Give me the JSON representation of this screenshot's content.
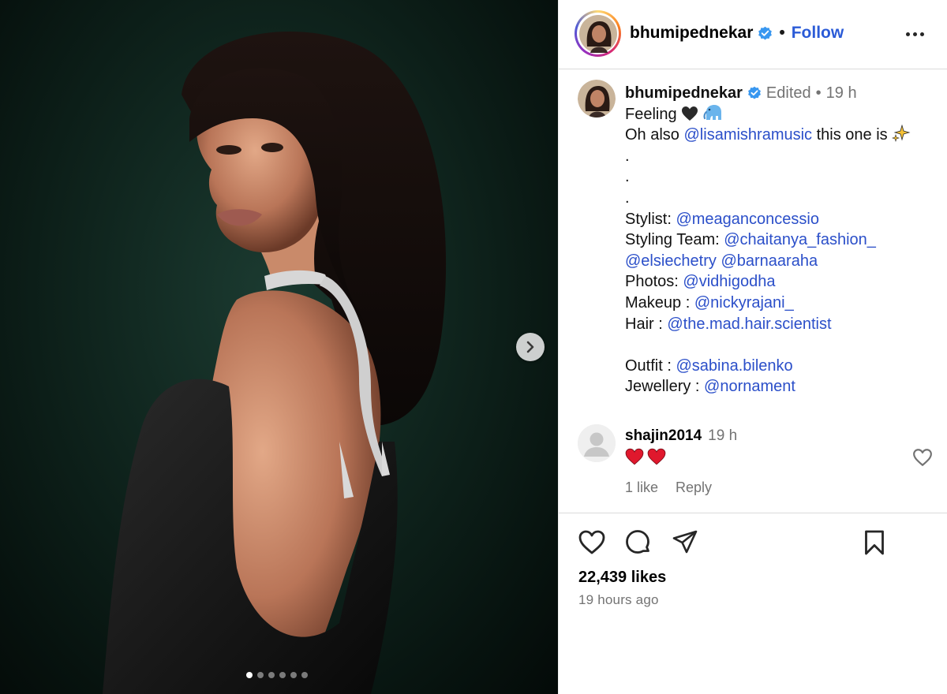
{
  "post": {
    "author": "bhumipednekar",
    "separator": "•",
    "follow_label": "Follow",
    "carousel": {
      "total_slides": 6,
      "current_slide": 1
    }
  },
  "caption": {
    "username": "bhumipednekar",
    "edited_label": "Edited",
    "dot": "•",
    "time": "19 h",
    "line1_text": "Feeling",
    "line2_prefix": "Oh also",
    "line2_mention": "@lisamishramusic",
    "line2_suffix": "this one is",
    "dot_lines": [
      ".",
      ".",
      "."
    ],
    "stylist_label": "Stylist:",
    "stylist": "@meaganconcessio",
    "styling_team_label": "Styling Team:",
    "styling_team_1": "@chaitanya_fashion_",
    "styling_team_2": "@elsiechetry",
    "styling_team_3": "@barnaaraha",
    "photos_label": "Photos:",
    "photos": "@vidhigodha",
    "makeup_label": "Makeup :",
    "makeup": "@nickyrajani_",
    "hair_label": "Hair :",
    "hair": "@the.mad.hair.scientist",
    "outfit_label": "Outfit :",
    "outfit": "@sabina.bilenko",
    "jewellery_label": "Jewellery :",
    "jewellery": "@nornament"
  },
  "comment": {
    "username": "shajin2014",
    "time": "19 h",
    "likes_label": "1 like",
    "reply_label": "Reply"
  },
  "footer": {
    "likes": "22,439 likes",
    "posted": "19 hours ago"
  },
  "colors": {
    "mention": "#2b4fc9",
    "follow": "#2b5bd7",
    "muted": "#737373",
    "verified": "#3897f0",
    "heart_emoji": "#e0182d"
  },
  "icons": [
    "verified-badge-icon",
    "more-options-icon",
    "chevron-right-icon",
    "black-heart-emoji",
    "elephant-emoji",
    "sparkles-emoji",
    "red-heart-emoji",
    "like-heart-icon",
    "comment-bubble-icon",
    "share-paper-plane-icon",
    "bookmark-icon",
    "default-avatar-icon"
  ]
}
